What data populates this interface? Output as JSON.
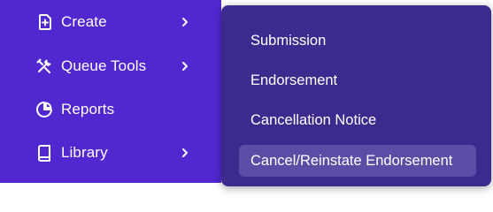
{
  "sidebar": {
    "items": [
      {
        "label": "Create",
        "icon": "plus-square-icon",
        "has_submenu": true
      },
      {
        "label": "Queue Tools",
        "icon": "tools-icon",
        "has_submenu": true
      },
      {
        "label": "Reports",
        "icon": "pie-chart-icon",
        "has_submenu": false
      },
      {
        "label": "Library",
        "icon": "book-icon",
        "has_submenu": true
      }
    ]
  },
  "submenu": {
    "items": [
      {
        "label": "Submission"
      },
      {
        "label": "Endorsement"
      },
      {
        "label": "Cancellation Notice"
      },
      {
        "label": "Cancel/Reinstate Endorsement",
        "highlighted": true
      }
    ]
  },
  "colors": {
    "sidebar_bg": "#5128d0",
    "submenu_bg": "#3d2a8f",
    "highlight_bg": "#5b4ca5",
    "text": "#ffffff"
  }
}
